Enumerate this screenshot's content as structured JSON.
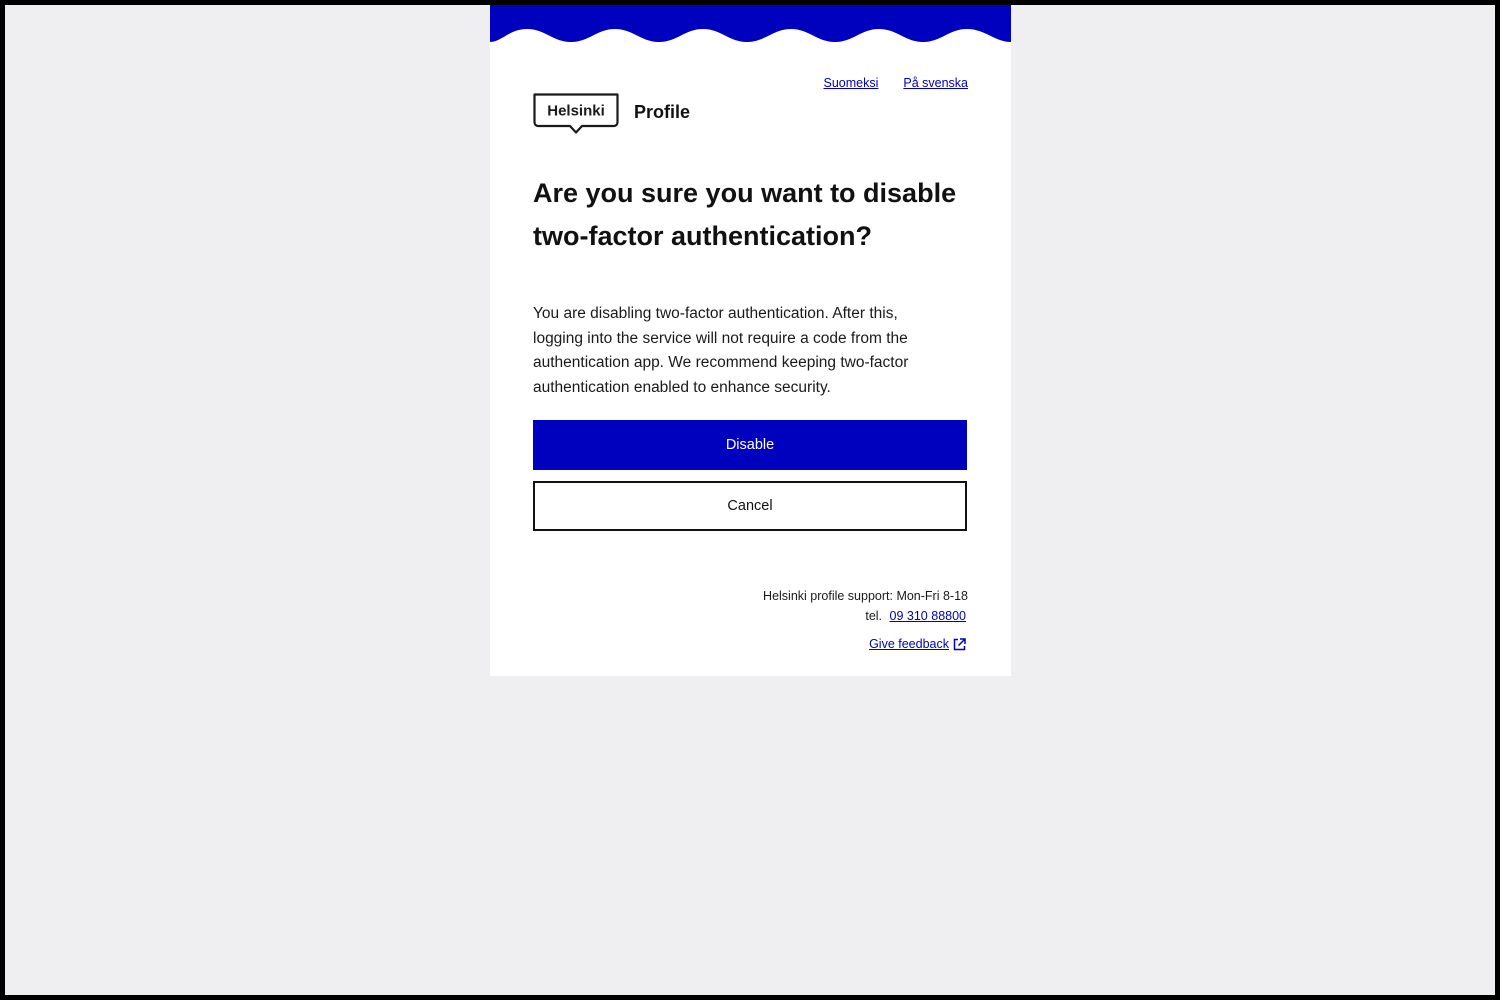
{
  "theme": {
    "brand_blue": "#0000bf",
    "page_background": "#efeff1",
    "card_background": "#ffffff",
    "frame": "#000000"
  },
  "languages": [
    {
      "label": "Suomeksi"
    },
    {
      "label": "På svenska"
    }
  ],
  "header": {
    "logo_text": "Helsinki",
    "title": "Profile"
  },
  "dialog": {
    "heading": "Are you sure you want to disable two-factor authentication?",
    "description": "You are disabling two-factor authentication. After this, logging into the service will not require a code from the authentication app. We recommend keeping two-factor authentication enabled to enhance security.",
    "confirm_label": "Disable",
    "cancel_label": "Cancel"
  },
  "footer": {
    "support_text": "Helsinki profile support: Mon-Fri 8-18",
    "tel_label": "tel.",
    "phone": "09 310 88800",
    "feedback_label": "Give feedback",
    "feedback_icon": "external-link-icon"
  }
}
